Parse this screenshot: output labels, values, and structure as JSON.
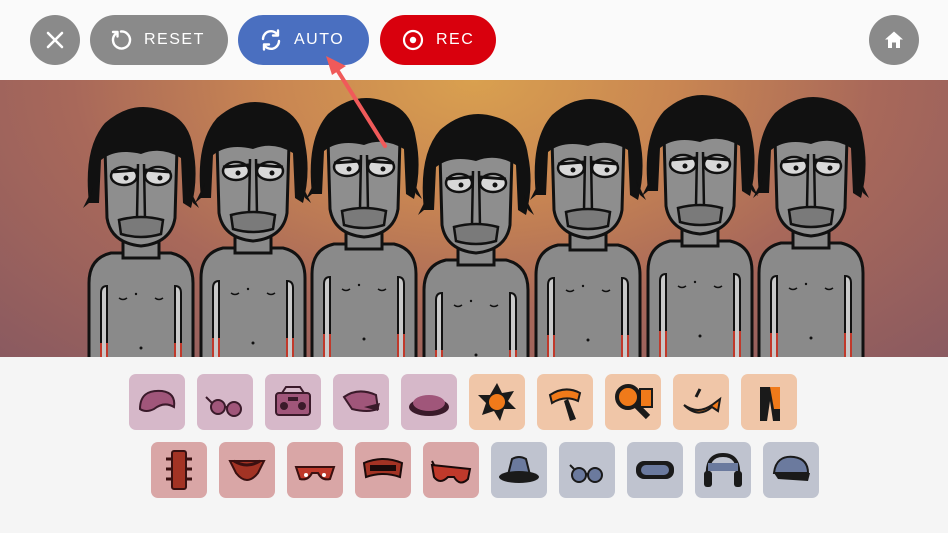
{
  "toolbar": {
    "close_icon": "close-icon",
    "reset_label": "RESET",
    "reset_icon": "reset-icon",
    "auto_label": "AUTO",
    "auto_icon": "refresh-icon",
    "rec_label": "REC",
    "rec_icon": "record-icon",
    "home_icon": "home-icon"
  },
  "colors": {
    "toolbar_gray": "#8a8a8a",
    "auto_blue": "#4a6fc0",
    "rec_red": "#d9000d",
    "annotation_arrow": "#f05a5a",
    "tray_pink": "#d6b8c9",
    "tray_orange": "#f0c6a8",
    "tray_red": "#d9a6a6",
    "tray_blue": "#bfc3cf"
  },
  "stage": {
    "character_count": 7
  },
  "tray": {
    "row1": [
      {
        "name": "beret-icon",
        "bg": "#d6b8c9"
      },
      {
        "name": "glasses-icon",
        "bg": "#d6b8c9"
      },
      {
        "name": "boombox-icon",
        "bg": "#d6b8c9"
      },
      {
        "name": "cap-icon",
        "bg": "#d6b8c9"
      },
      {
        "name": "hat-icon",
        "bg": "#d6b8c9"
      },
      {
        "name": "sun-icon",
        "bg": "#f0c6a8"
      },
      {
        "name": "scarf-icon",
        "bg": "#f0c6a8"
      },
      {
        "name": "magnifier-icon",
        "bg": "#f0c6a8"
      },
      {
        "name": "fish-icon",
        "bg": "#f0c6a8"
      },
      {
        "name": "pants-icon",
        "bg": "#f0c6a8"
      }
    ],
    "row2": [
      {
        "name": "traffic-light-icon",
        "bg": "#d9a6a6"
      },
      {
        "name": "bandana-icon",
        "bg": "#d9a6a6"
      },
      {
        "name": "red-glasses-icon",
        "bg": "#d9a6a6"
      },
      {
        "name": "mask-icon",
        "bg": "#d9a6a6"
      },
      {
        "name": "sunglasses-icon",
        "bg": "#d9a6a6"
      },
      {
        "name": "bucket-hat-icon",
        "bg": "#bfc3cf"
      },
      {
        "name": "round-glasses-icon",
        "bg": "#bfc3cf"
      },
      {
        "name": "goggles-icon",
        "bg": "#bfc3cf"
      },
      {
        "name": "headphones-icon",
        "bg": "#bfc3cf"
      },
      {
        "name": "baseball-cap-icon",
        "bg": "#bfc3cf"
      }
    ]
  }
}
